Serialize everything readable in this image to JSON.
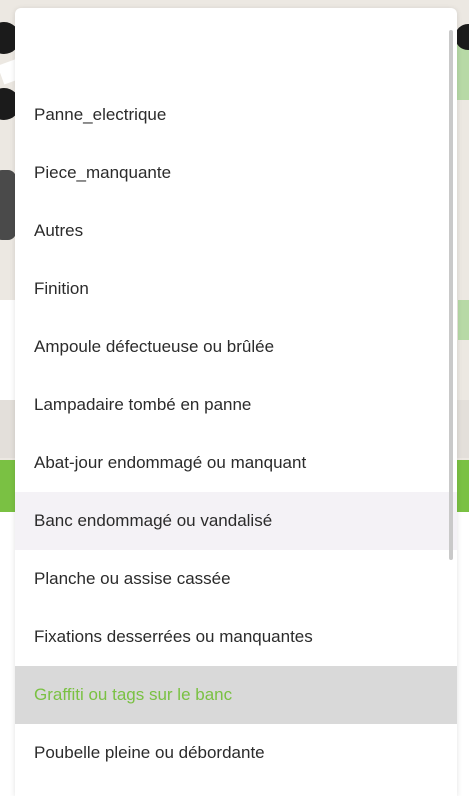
{
  "dropdown": {
    "options": [
      {
        "label": "Panne_electrique"
      },
      {
        "label": "Piece_manquante"
      },
      {
        "label": "Autres"
      },
      {
        "label": "Finition"
      },
      {
        "label": "Ampoule défectueuse ou brûlée"
      },
      {
        "label": "Lampadaire tombé en panne"
      },
      {
        "label": "Abat-jour endommagé ou manquant"
      },
      {
        "label": "Banc endommagé ou vandalisé",
        "state": "hover"
      },
      {
        "label": "Planche ou assise cassée"
      },
      {
        "label": "Fixations desserrées ou manquantes"
      },
      {
        "label": "Graffiti ou tags sur le banc",
        "state": "selected"
      },
      {
        "label": "Poubelle pleine ou débordante"
      }
    ],
    "accent_color": "#7ac143"
  }
}
